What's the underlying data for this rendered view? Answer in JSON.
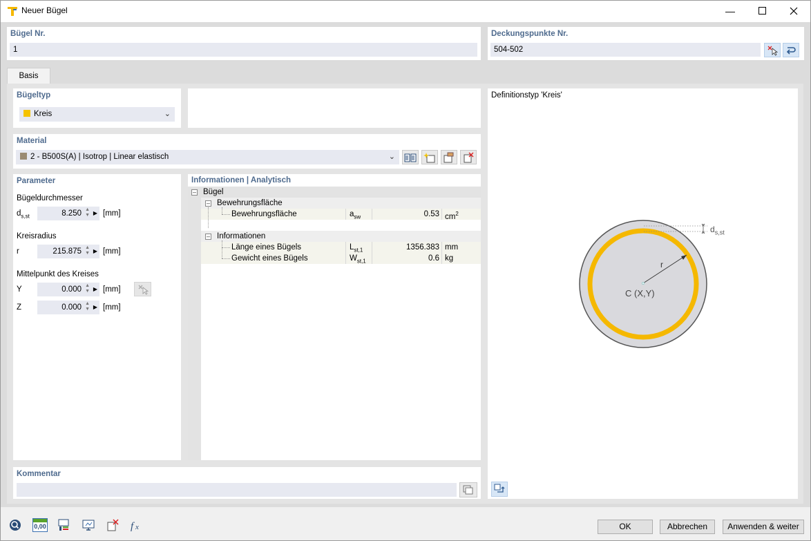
{
  "window": {
    "title": "Neuer Bügel"
  },
  "header": {
    "stirrup_no_label": "Bügel Nr.",
    "stirrup_no_value": "1",
    "cover_points_label": "Deckungspunkte Nr.",
    "cover_points_value": "504-502"
  },
  "tabs": [
    {
      "label": "Basis"
    }
  ],
  "stirrup_type": {
    "label": "Bügeltyp",
    "value": "Kreis",
    "color": "#f5c300"
  },
  "material": {
    "label": "Material",
    "value": "2 - B500S(A) | Isotrop | Linear elastisch",
    "color": "#9b8b72"
  },
  "parameters": {
    "title": "Parameter",
    "diameter": {
      "label": "Bügeldurchmesser",
      "symbol_main": "d",
      "symbol_sub": "s,st",
      "value": "8.250",
      "unit": "[mm]"
    },
    "radius": {
      "label": "Kreisradius",
      "symbol": "r",
      "value": "215.875",
      "unit": "[mm]"
    },
    "center": {
      "label": "Mittelpunkt des Kreises",
      "y": {
        "symbol": "Y",
        "value": "0.000",
        "unit": "[mm]"
      },
      "z": {
        "symbol": "Z",
        "value": "0.000",
        "unit": "[mm]"
      }
    }
  },
  "info": {
    "title": "Informationen | Analytisch",
    "root": "Bügel",
    "group1": "Bewehrungsfläche",
    "row1": {
      "label": "Bewehrungsfläche",
      "sym_main": "a",
      "sym_sub": "sw",
      "value": "0.53",
      "unit_main": "cm",
      "unit_sup": "2"
    },
    "group2": "Informationen",
    "row2": {
      "label": "Länge eines Bügels",
      "sym_main": "L",
      "sym_sub": "st,1",
      "value": "1356.383",
      "unit": "mm"
    },
    "row3": {
      "label": "Gewicht eines Bügels",
      "sym_main": "W",
      "sym_sub": "st,1",
      "value": "0.6",
      "unit": "kg"
    }
  },
  "preview": {
    "title": "Definitionstyp 'Kreis'",
    "radius_label": "r",
    "center_label": "C (X,Y)",
    "dim_main": "d",
    "dim_sub": "s,st"
  },
  "comment": {
    "label": "Kommentar",
    "value": ""
  },
  "buttons": {
    "ok": "OK",
    "cancel": "Abbrechen",
    "apply": "Anwenden & weiter"
  },
  "toolbar": {
    "units_label": "0,00"
  }
}
